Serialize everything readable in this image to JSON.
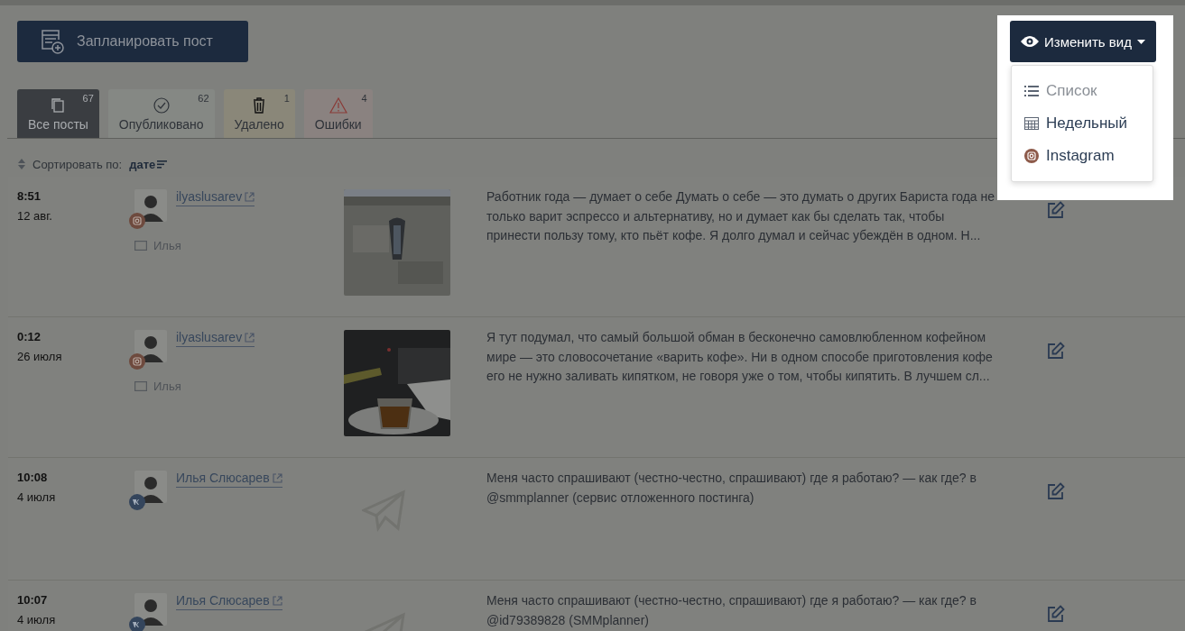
{
  "schedule_button": {
    "label": "Запланировать пост"
  },
  "view_button": {
    "label": "Изменить вид",
    "expanded": true
  },
  "view_menu": [
    {
      "kind": "list",
      "label": "Список",
      "disabled": true
    },
    {
      "kind": "week",
      "label": "Недельный",
      "disabled": false
    },
    {
      "kind": "instagram",
      "label": "Instagram",
      "disabled": false
    }
  ],
  "tabs": [
    {
      "kind": "all",
      "label": "Все посты",
      "count": "67",
      "selected": true
    },
    {
      "kind": "published",
      "label": "Опубликовано",
      "count": "62",
      "selected": false
    },
    {
      "kind": "deleted",
      "label": "Удалено",
      "count": "1",
      "selected": false
    },
    {
      "kind": "errors",
      "label": "Ошибки",
      "count": "4",
      "selected": false
    }
  ],
  "sort": {
    "label": "Сортировать по:",
    "value": "дате"
  },
  "posts": [
    {
      "time": "8:51",
      "date": "12 авг.",
      "network": {
        "kind": "instagram"
      },
      "account": "ilyaslusarev",
      "user": "Илья",
      "media": {
        "kind": "picture"
      },
      "text_lines": [
        "Работник года — думает о себе Думать о себе — это думать о других Бариста года не",
        "только варит эспрессо и альтернативу, но и думает как бы сделать так, чтобы",
        "принести пользу тому, кто пьёт кофе. Я долго думал и сейчас убеждён в одном. Н..."
      ]
    },
    {
      "time": "0:12",
      "date": "26 июля",
      "network": {
        "kind": "instagram"
      },
      "account": "ilyaslusarev",
      "user": "Илья",
      "media": {
        "kind": "picture"
      },
      "text_lines": [
        "Я тут подумал, что самый большой обман в бесконечно самовлюбленном кофейном",
        "мире — это словосочетание «варить кофе». Ни в одном способе приготовления кофе",
        "его не нужно заливать кипятком, не говоря уже о том, чтобы кипятить. В лучшем сл..."
      ]
    },
    {
      "time": "10:08",
      "date": "4 июля",
      "network": {
        "kind": "vk"
      },
      "account": "Илья Слюсарев",
      "media": {
        "kind": "empty"
      },
      "text_lines": [
        "Меня часто спрашивают (честно-честно, спрашивают) где я работаю? — как где? в",
        "@smmplanner (сервис отложенного постинга)"
      ]
    },
    {
      "time": "10:07",
      "date": "4 июля",
      "network": {
        "kind": "vk"
      },
      "account": "Илья Слюсарев",
      "media": {
        "kind": "empty"
      },
      "text_lines": [
        "Меня часто спрашивают (честно-честно, спрашивают) где я работаю? — как где? в",
        "@id79389828 (SMMplanner)"
      ]
    }
  ]
}
